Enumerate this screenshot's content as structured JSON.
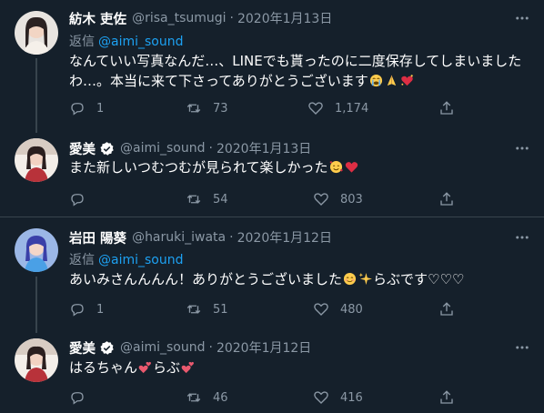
{
  "colors": {
    "background": "#15202b",
    "accent": "#1da1f2",
    "muted": "#8b98a5",
    "divider": "#38444d",
    "verified": "#ffffff"
  },
  "tweets": [
    {
      "name": "紡木 吏佐",
      "handle": "@risa_tsumugi",
      "date": "2020年1月13日",
      "reply_label": "返信",
      "reply_to": "@aimi_sound",
      "text_line1": "なんていい写真なんだ…、LINEでも貰ったのに二度保存してしまいました",
      "text_line2": "わ…。本当に来て下さってありがとうございます",
      "emojis": [
        "crying-face",
        "folded-hands",
        "sparkling-heart"
      ],
      "counts": {
        "reply": "1",
        "retweet": "73",
        "like": "1,174"
      }
    },
    {
      "name": "愛美",
      "handle": "@aimi_sound",
      "date": "2020年1月13日",
      "verified": true,
      "text": "また新しいつむつむが見られて楽しかった",
      "emojis": [
        "smiling-face-with-hearts",
        "red-heart"
      ],
      "counts": {
        "reply": "",
        "retweet": "54",
        "like": "803"
      }
    },
    {
      "name": "岩田 陽葵",
      "handle": "@haruki_iwata",
      "date": "2020年1月12日",
      "reply_label": "返信",
      "reply_to": "@aimi_sound",
      "text": "あいみさんんんん！ありがとうございました",
      "text_after": "らぶです♡♡♡",
      "emojis": [
        "smiling-face",
        "sparkles"
      ],
      "counts": {
        "reply": "1",
        "retweet": "51",
        "like": "480"
      }
    },
    {
      "name": "愛美",
      "handle": "@aimi_sound",
      "date": "2020年1月12日",
      "verified": true,
      "text_a": "はるちゃん",
      "text_b": "らぶ",
      "emojis": [
        "two-hearts",
        "two-hearts"
      ],
      "counts": {
        "reply": "",
        "retweet": "46",
        "like": "416"
      }
    }
  ]
}
